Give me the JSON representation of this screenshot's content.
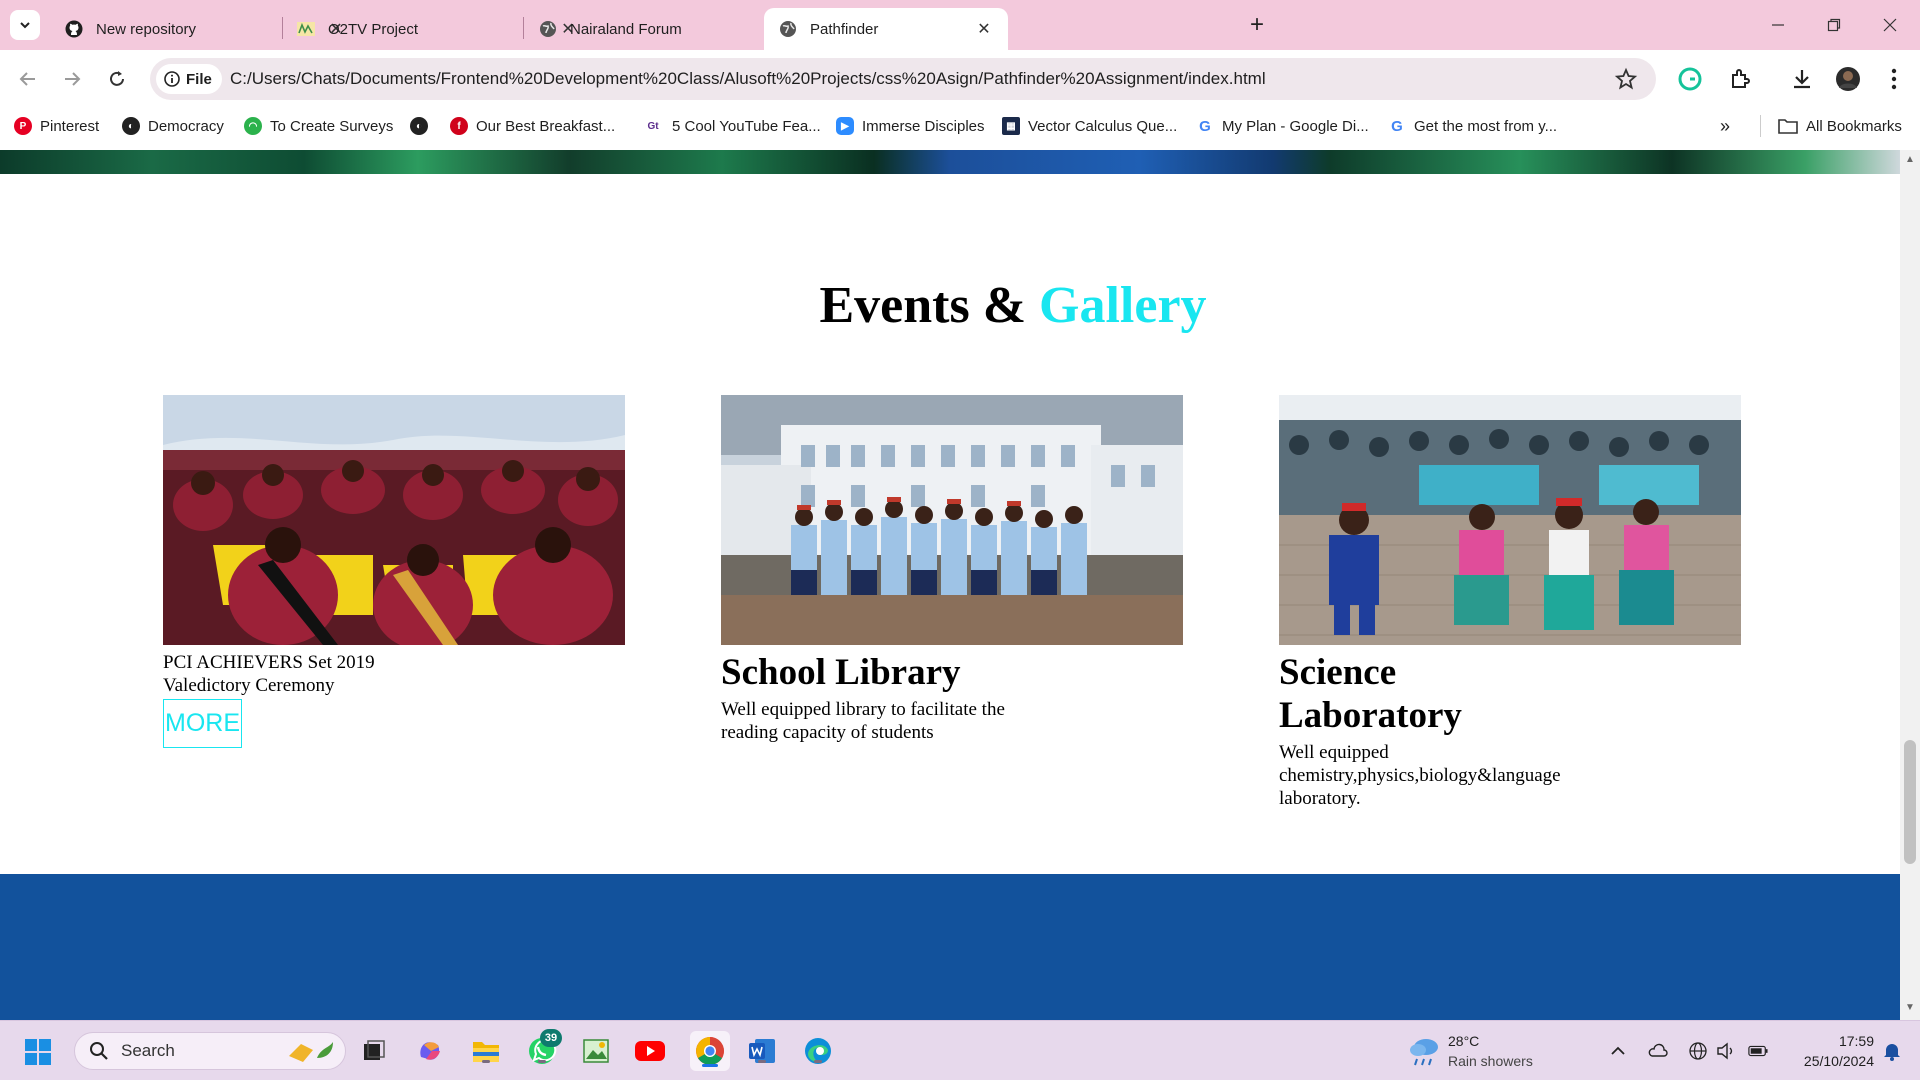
{
  "browser": {
    "tabs": [
      {
        "label": "New repository",
        "icon": "github-icon"
      },
      {
        "label": "O2TV Project",
        "icon": "o2tv-icon"
      },
      {
        "label": "Nairaland Forum",
        "icon": "globe-icon"
      },
      {
        "label": "Pathfinder",
        "icon": "globe-icon",
        "active": true
      }
    ],
    "site_chip": "File",
    "url": "C:/Users/Chats/Documents/Frontend%20Development%20Class/Alusoft%20Projects/css%20Asign/Pathfinder%20Assignment/index.html",
    "bookmarks": [
      {
        "label": "Pinterest",
        "icon": "pinterest-icon",
        "color": "#e60023"
      },
      {
        "label": "Democracy",
        "icon": "globe-icon",
        "color": "#222222"
      },
      {
        "label": "To Create Surveys",
        "icon": "survey-icon",
        "color": "#2bb24c"
      },
      {
        "label": "",
        "icon": "globe-icon",
        "color": "#222222"
      },
      {
        "label": "Our Best Breakfast...",
        "icon": "food-icon",
        "color": "#d0021b"
      },
      {
        "label": "5 Cool YouTube Fea...",
        "icon": "gc-icon",
        "color": "#5b2d8c"
      },
      {
        "label": "Immerse Disciples",
        "icon": "zoom-icon",
        "color": "#2d8cff"
      },
      {
        "label": "Vector Calculus Que...",
        "icon": "calc-icon",
        "color": "#1b2a4a"
      },
      {
        "label": "My Plan - Google Di...",
        "icon": "google-icon",
        "color": "#4285f4"
      },
      {
        "label": "Get the most from y...",
        "icon": "google-icon",
        "color": "#4285f4"
      }
    ],
    "all_bookmarks": "All Bookmarks"
  },
  "page": {
    "title_main": "Events &",
    "title_accent": "Gallery",
    "accent_color": "#19e6f0",
    "footer_color": "#12529c",
    "cards": [
      {
        "caption_line1": "PCI ACHIEVERS Set 2019",
        "caption_line2": "Valedictory Ceremony",
        "more": "MORE"
      },
      {
        "heading": "School Library",
        "desc": "Well equipped library to facilitate the reading capacity of students"
      },
      {
        "heading_line1": "Science",
        "heading_line2": "Laboratory",
        "desc": "Well equipped chemistry,physics,biology&language laboratory."
      }
    ]
  },
  "taskbar": {
    "search": "Search",
    "whatsapp_badge": "39",
    "weather_temp": "28°C",
    "weather_cond": "Rain showers",
    "time": "17:59",
    "date": "25/10/2024"
  }
}
